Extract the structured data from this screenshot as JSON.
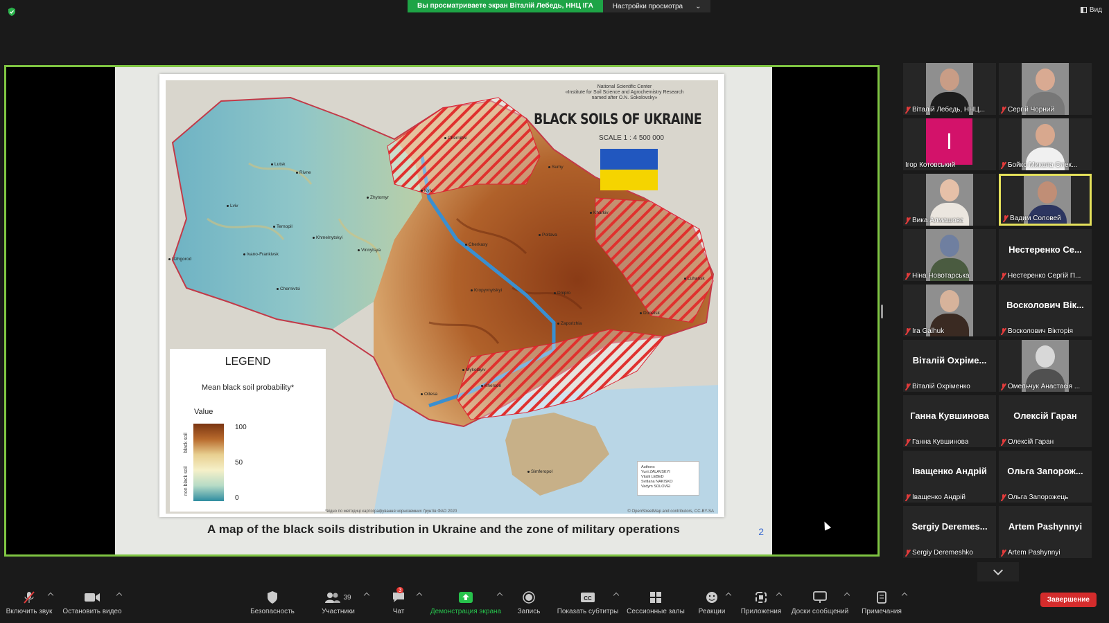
{
  "top": {
    "share_banner": "Вы просматриваете экран Віталій Лебедь, ННЦ ІГА",
    "view_options": "Настройки просмотра",
    "view_button": "Вид"
  },
  "slide": {
    "org_line1": "National Scientific Center",
    "org_line2": "«Institute for Soil Science and Agrochemistry Research",
    "org_line3": "named after O.N. Sokolovsky»",
    "map_title": "BLACK SOILS OF UKRAINE",
    "scale": "SCALE 1 : 4 500 000",
    "legend_title": "LEGEND",
    "legend_subtitle": "Mean black soil probability*",
    "legend_value_label": "Value",
    "legend_max": "100",
    "legend_mid": "50",
    "legend_min": "0",
    "legend_side_top": "black soil",
    "legend_side_bottom": "non black soil",
    "authors_label": "Authors:",
    "authors": [
      "Yurii ZALAVSKYI",
      "Vitalii LEBED",
      "Svitlana NAKISKO",
      "Vadym SOLOVEI"
    ],
    "footnote_left": "*відно по методиці картографування чорноземних ґрунтів ФАО 2020",
    "footnote_right": "© OpenStreetMap and contributors, CC-BY-SA",
    "caption": "A map of the black soils distribution in Ukraine and the zone of military operations",
    "page_number": "2",
    "cities": {
      "chernihiv": "Chernihiv",
      "sumy": "Sumy",
      "lutsk": "Lutsk",
      "rivne": "Rivne",
      "zhytomyr": "Zhytomyr",
      "kyiv": "Kyiv",
      "lviv": "Lviv",
      "ternopil": "Ternopil",
      "khmelnytskyi": "Khmelnytskyi",
      "vinnytsya": "Vinnytsya",
      "cherkasy": "Cherkasy",
      "poltava": "Poltava",
      "kharkiv": "Kharkiv",
      "uzhgorod": "Uzhgorod",
      "ivano_frankivsk": "Ivano-Frankivsk",
      "chernivtsi": "Chernivtsi",
      "kropyvnytskyi": "Kropyvnytskyi",
      "dnipro": "Dnipro",
      "luhansk": "Luhansk",
      "donetsk": "Donetsk",
      "zaporizhia": "Zaporizhia",
      "mykolayiv": "Mykolayiv",
      "kherson": "Kherson",
      "odesa": "Odesa",
      "simferopol": "Simferopol"
    }
  },
  "participants": [
    {
      "name": "Віталій Лебедь, ННЦ...",
      "type": "video",
      "skin": "#c99d86",
      "shirt": "#1d1d1d"
    },
    {
      "name": "Сергій Чорний",
      "type": "video",
      "skin": "#d9aa92",
      "shirt": "#777777"
    },
    {
      "name": "Ігор Котовський",
      "type": "avatar",
      "letter": "I"
    },
    {
      "name": "Бойко Микола Олек...",
      "type": "video",
      "skin": "#d8a88e",
      "shirt": "#f0f0f0"
    },
    {
      "name": "Вика Алмашова",
      "type": "video",
      "skin": "#e6c0a8",
      "shirt": "#ebe6df"
    },
    {
      "name": "Вадим Соловей",
      "type": "video",
      "skin": "#c08e76",
      "shirt": "#2c3560"
    },
    {
      "name": "Ніна Новотарська",
      "type": "video",
      "skin": "#6f7fa0",
      "shirt": "#4a5b40"
    },
    {
      "name": "Нестеренко Сергій П...",
      "type": "name",
      "big": "Нестеренко Се..."
    },
    {
      "name": "Ira Galhuk",
      "type": "video",
      "skin": "#d7b39b",
      "shirt": "#3a2a22"
    },
    {
      "name": "Восколович Вікторія",
      "type": "name",
      "big": "Восколович Вік..."
    },
    {
      "name": "Віталій Охріменко",
      "type": "name",
      "big": "Віталій Охріме..."
    },
    {
      "name": "Омельчук Анастасія ...",
      "type": "video",
      "skin": "#d8d8d8",
      "shirt": "#505050"
    },
    {
      "name": "Ганна Кувшинова",
      "type": "name",
      "big": "Ганна Кувшинова"
    },
    {
      "name": "Олексій Гаран",
      "type": "name",
      "big": "Олексій Гаран"
    },
    {
      "name": "Іващенко Андрій",
      "type": "name",
      "big": "Іващенко Андрій"
    },
    {
      "name": "Ольга Запорожець",
      "type": "name",
      "big": "Ольга Запорож..."
    },
    {
      "name": "Sergiy Deremeshko",
      "type": "name",
      "big": "Sergiy Deremes..."
    },
    {
      "name": "Artem Pashynnyi",
      "type": "name",
      "big": "Artem Pashynnyi"
    }
  ],
  "toolbar": {
    "unmute": "Включить звук",
    "stop_video": "Остановить видео",
    "security": "Безопасность",
    "participants": "Участники",
    "participants_count": "39",
    "chat": "Чат",
    "chat_badge": "3",
    "share_screen": "Демонстрация экрана",
    "record": "Запись",
    "captions": "Показать субтитры",
    "breakout": "Сессионные залы",
    "reactions": "Реакции",
    "apps": "Приложения",
    "whiteboards": "Доски сообщений",
    "notes": "Примечания",
    "end": "Завершение"
  }
}
